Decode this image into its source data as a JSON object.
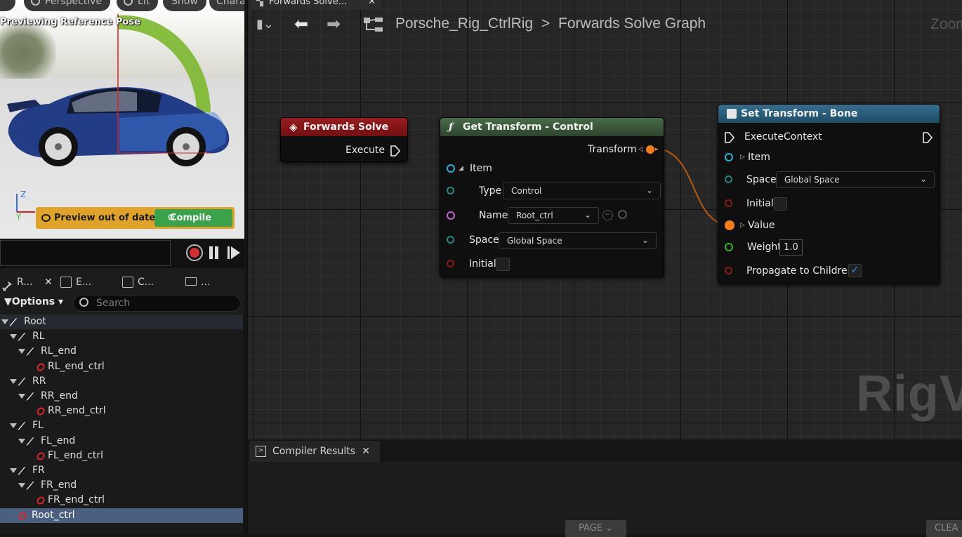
{
  "viewport": {
    "buttons": {
      "perspective": "Perspective",
      "lit": "Lit",
      "show": "Show",
      "character": "Chara"
    },
    "status_label": "Previewing Reference Pose",
    "axes": {
      "z": "Z",
      "y": "Y"
    },
    "preview_label": "Preview out of date",
    "compile_label": "Compile"
  },
  "hierarchy": {
    "tabs": [
      {
        "label": "R...",
        "icon": "bone-icon"
      },
      {
        "label": "E...",
        "icon": "copy-icon"
      },
      {
        "label": "C...",
        "icon": "curve-icon"
      },
      {
        "label": "...",
        "icon": "book-icon"
      }
    ],
    "options_label": "Options",
    "search_placeholder": "Search",
    "items": [
      {
        "label": "Root",
        "type": "bone"
      },
      {
        "label": "RL",
        "type": "bone"
      },
      {
        "label": "RL_end",
        "type": "bone"
      },
      {
        "label": "RL_end_ctrl",
        "type": "control"
      },
      {
        "label": "RR",
        "type": "bone"
      },
      {
        "label": "RR_end",
        "type": "bone"
      },
      {
        "label": "RR_end_ctrl",
        "type": "control"
      },
      {
        "label": "FL",
        "type": "bone"
      },
      {
        "label": "FL_end",
        "type": "bone"
      },
      {
        "label": "FL_end_ctrl",
        "type": "control"
      },
      {
        "label": "FR",
        "type": "bone"
      },
      {
        "label": "FR_end",
        "type": "bone"
      },
      {
        "label": "FR_end_ctrl",
        "type": "control"
      },
      {
        "label": "Root_ctrl",
        "type": "control",
        "selected": true
      }
    ]
  },
  "graph": {
    "tab_label": "Forwards Solve...",
    "breadcrumb": {
      "asset": "Porsche_Rig_CtrlRig",
      "separator": ">",
      "graph": "Forwards Solve Graph"
    },
    "zoom_label": "Zoom",
    "watermark": "RigVM",
    "nodes": {
      "forwards_solve": {
        "title": "Forwards Solve",
        "execute_label": "Execute",
        "color": "#8a1618"
      },
      "get_transform": {
        "title": "Get Transform - Control",
        "transform_label": "Transform",
        "item_label": "Item",
        "type_label": "Type",
        "type_value": "Control",
        "name_label": "Name",
        "name_value": "Root_ctrl",
        "space_label": "Space",
        "space_value": "Global Space",
        "initial_label": "Initial",
        "color": "#3e5a3e"
      },
      "set_transform": {
        "title": "Set Transform - Bone",
        "execute_label": "ExecuteContext",
        "item_label": "Item",
        "space_label": "Space",
        "space_value": "Global Space",
        "initial_label": "Initial",
        "value_label": "Value",
        "weight_label": "Weight",
        "weight_value": "1.0",
        "propagate_label": "Propagate to Children",
        "propagate_checked": true,
        "color": "#2b5f7c"
      }
    }
  },
  "compiler": {
    "tab_label": "Compiler Results",
    "page_label": "PAGE",
    "clear_label": "CLEA"
  },
  "colors": {
    "accent_orange": "#f47d16",
    "pin_cyan": "#1fb6cf",
    "pin_teal": "#24897e",
    "pin_magenta": "#c065d8",
    "pin_red": "#8a1a1a",
    "pin_green": "#35b02b",
    "compile_green": "#3aa24a",
    "warning_yellow": "#e0a32a",
    "selection_blue": "#4b6080"
  }
}
